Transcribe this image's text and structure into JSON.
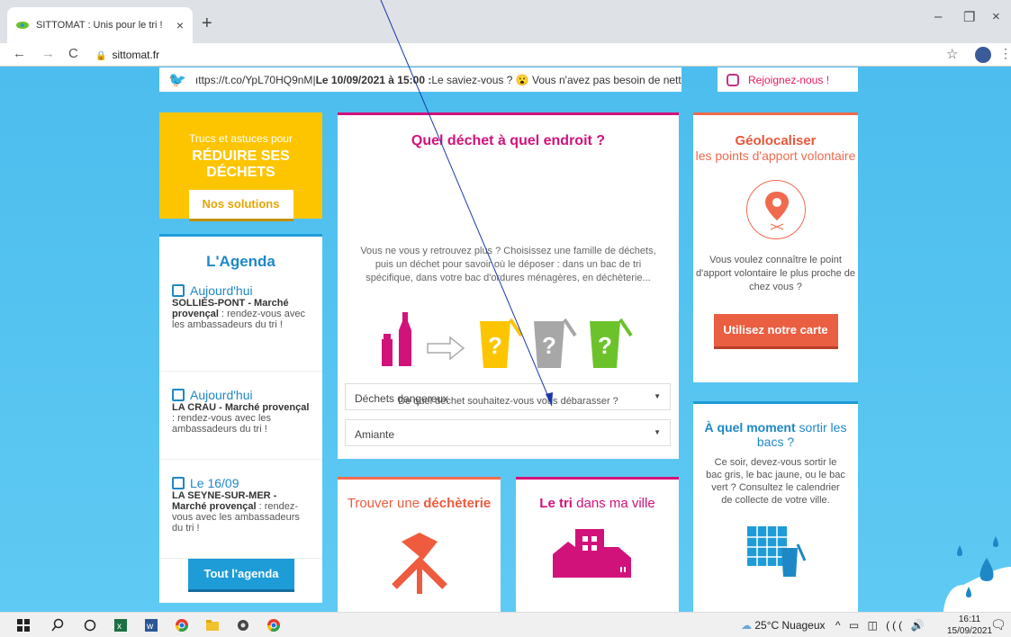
{
  "browser": {
    "tab_title": "SITTOMAT : Unis pour le tri !",
    "tab_close": "×",
    "new_tab": "+",
    "url": "sittomat.fr",
    "back": "←",
    "forward": "→",
    "reload": "C",
    "star": "☆",
    "kebab": "⋮",
    "minimize": "–",
    "restore": "❐",
    "close": "×"
  },
  "social": {
    "twitter_text_link": "ıttps://t.co/YpL70HQ9nM",
    "twitter_sep": " | ",
    "twitter_date": "Le 10/09/2021 à 15:00 :",
    "twitter_rest": " Le saviez-vous ? 😮 Vous n'avez pas besoin de nettoyer vo",
    "instagram_text": "Rejoignez-nous !"
  },
  "yellow_card": {
    "small": "Trucs et astuces pour",
    "big": "RÉDUIRE SES DÉCHETS",
    "button": "Nos solutions"
  },
  "agenda": {
    "title": "L'Agenda",
    "items": [
      {
        "date": "Aujourd'hui",
        "bold": "SOLLIÈS-PONT - Marché provençal",
        "rest": " : rendez-vous avec les ambassadeurs du tri !"
      },
      {
        "date": "Aujourd'hui",
        "bold": "LA CRAU - Marché provençal",
        "rest": " : rendez-vous avec les ambassadeurs du tri !"
      },
      {
        "date": "Le 16/09",
        "bold": "LA SEYNE-SUR-MER - Marché provençal",
        "rest": " : rendez-vous avec les ambassadeurs du tri !"
      }
    ],
    "button": "Tout l'agenda"
  },
  "waste": {
    "title": "Quel déchet à quel endroit ?",
    "description": "Vous ne vous y retrouvez plus ? Choisissez une famille de déchets, puis un déchet pour savoir où le déposer : dans un bac de tri spécifique, dans votre bac d'ordures ménagères, en déchèterie...",
    "question": "De quel déchet souhaitez-vous vous débarasser ?",
    "select_family": "Déchets dangereux",
    "select_item": "Amiante",
    "bin_mark": "?"
  },
  "geo": {
    "title": "Géolocaliser",
    "subtitle": "les points d'apport volontaire",
    "text": "Vous voulez connaître le point d'apport volontaire le plus proche de chez vous ?",
    "button": "Utilisez notre carte"
  },
  "moment": {
    "title_bold": "À quel moment",
    "title_rest": " sortir les bacs ?",
    "text": "Ce soir, devez-vous sortir le bac gris, le bac jaune, ou le bac vert ? Consultez le calendrier de collecte de votre ville."
  },
  "dech": {
    "title_plain": "Trouver une ",
    "title_bold": "déchèterie"
  },
  "ville": {
    "title_bold": "Le tri",
    "title_rest": " dans ma ville"
  },
  "taskbar": {
    "weather": "25°C Nuageux",
    "time": "16:11",
    "date": "15/09/2021"
  },
  "colors": {
    "magenta": "#d2127b",
    "orange": "#f06a4e",
    "blue": "#1e9cd7",
    "yellow": "#fcc500",
    "green": "#6cc22b",
    "grey": "#a7a7a7"
  }
}
